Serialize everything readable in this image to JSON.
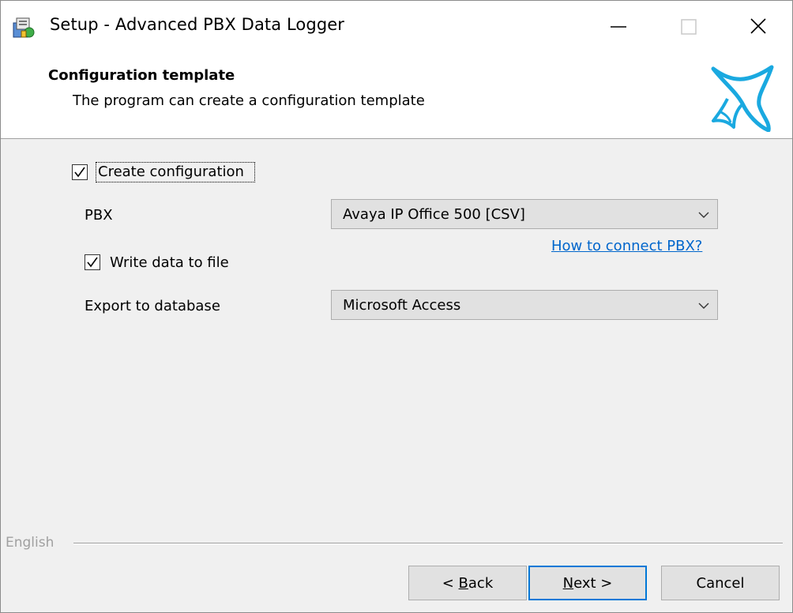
{
  "window": {
    "title": "Setup - Advanced PBX Data Logger",
    "controls": {
      "minimize": "minimize",
      "maximize": "maximize",
      "close": "close"
    }
  },
  "header": {
    "title": "Configuration template",
    "subtitle": "The program can create a configuration template",
    "logo_icon": "propeller-logo-icon"
  },
  "form": {
    "create_config": {
      "label": "Create configuration",
      "checked": true
    },
    "pbx": {
      "label": "PBX",
      "selected": "Avaya IP Office 500 [CSV]"
    },
    "help_link": "How to connect PBX?",
    "write_file": {
      "label": "Write data to file",
      "checked": true
    },
    "export": {
      "label": "Export to database",
      "selected": "Microsoft Access"
    }
  },
  "footer": {
    "language": "English",
    "back_prefix": "< ",
    "back_accel": "B",
    "back_rest": "ack",
    "next_accel": "N",
    "next_rest": "ext >",
    "cancel_label": "Cancel"
  },
  "colors": {
    "accent": "#0078d7",
    "link": "#0066cc",
    "logo": "#1aa9e0",
    "button_face": "#e1e1e1",
    "window_bg": "#f0f0f0"
  }
}
